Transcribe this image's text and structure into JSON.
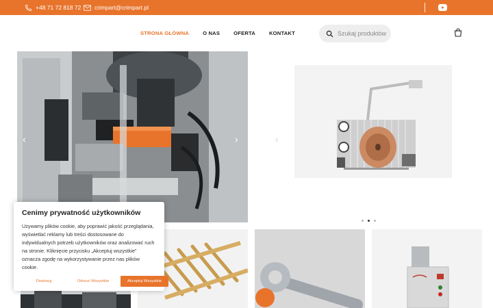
{
  "topbar": {
    "phone": "+48 71 72 818 72",
    "email": "crimpart@crimpart.pl"
  },
  "nav": {
    "items": [
      {
        "label": "STRONA GŁÓWNA",
        "active": true
      },
      {
        "label": "O NAS"
      },
      {
        "label": "OFERTA"
      },
      {
        "label": "KONTAKT"
      }
    ]
  },
  "search": {
    "placeholder": "Szukaj produktów"
  },
  "slider": {
    "active_dot": 2,
    "dot_count": 3
  },
  "cookie": {
    "title": "Cenimy prywatność użytkowników",
    "text": "Używamy plików cookie, aby poprawić jakość przeglądania, wyświetlać reklamy lub treści dostosowane do indywidualnych potrzeb użytkowników oraz analizować ruch na stronie. Kliknięcie przycisku „Akceptuj wszystkie” oznacza zgodę na wykorzystywanie przez nas plików cookie.",
    "customize": "Dostosuj",
    "reject": "Odrzuć Wszystkie",
    "accept": "Akceptuj Wszystkie"
  },
  "colors": {
    "accent": "#e8742c"
  },
  "icons": [
    "phone-icon",
    "mail-icon",
    "youtube-icon",
    "search-icon",
    "shopping-bag-icon",
    "chevron-left-icon",
    "chevron-right-icon"
  ]
}
